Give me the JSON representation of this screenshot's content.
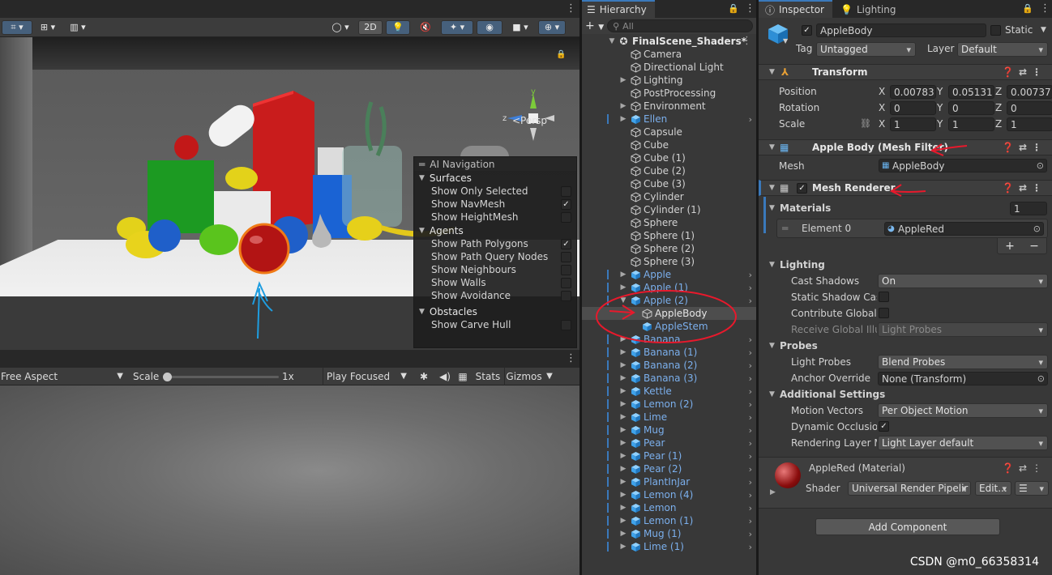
{
  "scene_toolbar": {
    "btn_2d": "2D",
    "kebab": "⋮"
  },
  "scene": {
    "persp_label": "<Persp",
    "gizmo_axes": {
      "y": "y",
      "z": "z"
    }
  },
  "ai_nav": {
    "title": "AI Navigation",
    "surfaces": "Surfaces",
    "surfaces_items": [
      {
        "label": "Show Only Selected",
        "checked": false
      },
      {
        "label": "Show NavMesh",
        "checked": true
      },
      {
        "label": "Show HeightMesh",
        "checked": false
      }
    ],
    "agents": "Agents",
    "agents_items": [
      {
        "label": "Show Path Polygons",
        "checked": true
      },
      {
        "label": "Show Path Query Nodes",
        "checked": false
      },
      {
        "label": "Show Neighbours",
        "checked": false
      },
      {
        "label": "Show Walls",
        "checked": false
      },
      {
        "label": "Show Avoidance",
        "checked": false
      }
    ],
    "obstacles": "Obstacles",
    "obstacles_items": [
      {
        "label": "Show Carve Hull",
        "checked": false
      }
    ]
  },
  "game_toolbar": {
    "aspect": "Free Aspect",
    "scale_label": "Scale",
    "scale_value": "1x",
    "scale_level": 0.0,
    "play_mode": "Play Focused",
    "stats": "Stats",
    "gizmos": "Gizmos"
  },
  "hierarchy": {
    "tab": "Hierarchy",
    "search_placeholder": "All",
    "add": "+",
    "scene_name": "FinalScene_Shaders*",
    "items": [
      {
        "label": "Camera",
        "prefab": false,
        "expand": "",
        "level": 1
      },
      {
        "label": "Directional Light",
        "prefab": false,
        "expand": "",
        "level": 1
      },
      {
        "label": "Lighting",
        "prefab": false,
        "expand": "▶",
        "level": 1
      },
      {
        "label": "PostProcessing",
        "prefab": false,
        "expand": "",
        "level": 1
      },
      {
        "label": "Environment",
        "prefab": false,
        "expand": "▶",
        "level": 1
      },
      {
        "label": "Ellen",
        "prefab": true,
        "expand": "▶",
        "level": 1,
        "chev": true,
        "bar": true
      },
      {
        "label": "Capsule",
        "prefab": false,
        "expand": "",
        "level": 1
      },
      {
        "label": "Cube",
        "prefab": false,
        "expand": "",
        "level": 1
      },
      {
        "label": "Cube (1)",
        "prefab": false,
        "expand": "",
        "level": 1
      },
      {
        "label": "Cube (2)",
        "prefab": false,
        "expand": "",
        "level": 1
      },
      {
        "label": "Cube (3)",
        "prefab": false,
        "expand": "",
        "level": 1
      },
      {
        "label": "Cylinder",
        "prefab": false,
        "expand": "",
        "level": 1
      },
      {
        "label": "Cylinder (1)",
        "prefab": false,
        "expand": "",
        "level": 1
      },
      {
        "label": "Sphere",
        "prefab": false,
        "expand": "",
        "level": 1
      },
      {
        "label": "Sphere (1)",
        "prefab": false,
        "expand": "",
        "level": 1
      },
      {
        "label": "Sphere (2)",
        "prefab": false,
        "expand": "",
        "level": 1
      },
      {
        "label": "Sphere (3)",
        "prefab": false,
        "expand": "",
        "level": 1
      },
      {
        "label": "Apple",
        "prefab": true,
        "expand": "▶",
        "level": 1,
        "chev": true,
        "bar": true
      },
      {
        "label": "Apple (1)",
        "prefab": true,
        "expand": "▶",
        "level": 1,
        "chev": true,
        "bar": true
      },
      {
        "label": "Apple (2)",
        "prefab": true,
        "expand": "▼",
        "level": 1,
        "chev": true,
        "bar": true
      },
      {
        "label": "AppleBody",
        "prefab": false,
        "expand": "",
        "level": 2,
        "selected": true
      },
      {
        "label": "AppleStem",
        "prefab": true,
        "expand": "",
        "level": 2
      },
      {
        "label": "Banana",
        "prefab": true,
        "expand": "▶",
        "level": 1,
        "chev": true,
        "bar": true
      },
      {
        "label": "Banana (1)",
        "prefab": true,
        "expand": "▶",
        "level": 1,
        "chev": true,
        "bar": true
      },
      {
        "label": "Banana (2)",
        "prefab": true,
        "expand": "▶",
        "level": 1,
        "chev": true,
        "bar": true
      },
      {
        "label": "Banana (3)",
        "prefab": true,
        "expand": "▶",
        "level": 1,
        "chev": true,
        "bar": true
      },
      {
        "label": "Kettle",
        "prefab": true,
        "expand": "▶",
        "level": 1,
        "chev": true,
        "bar": true
      },
      {
        "label": "Lemon (2)",
        "prefab": true,
        "expand": "▶",
        "level": 1,
        "chev": true,
        "bar": true
      },
      {
        "label": "Lime",
        "prefab": true,
        "expand": "▶",
        "level": 1,
        "chev": true,
        "bar": true
      },
      {
        "label": "Mug",
        "prefab": true,
        "expand": "▶",
        "level": 1,
        "chev": true,
        "bar": true
      },
      {
        "label": "Pear",
        "prefab": true,
        "expand": "▶",
        "level": 1,
        "chev": true,
        "bar": true
      },
      {
        "label": "Pear (1)",
        "prefab": true,
        "expand": "▶",
        "level": 1,
        "chev": true,
        "bar": true
      },
      {
        "label": "Pear (2)",
        "prefab": true,
        "expand": "▶",
        "level": 1,
        "chev": true,
        "bar": true
      },
      {
        "label": "PlantInJar",
        "prefab": true,
        "expand": "▶",
        "level": 1,
        "chev": true,
        "bar": true
      },
      {
        "label": "Lemon (4)",
        "prefab": true,
        "expand": "▶",
        "level": 1,
        "chev": true,
        "bar": true
      },
      {
        "label": "Lemon",
        "prefab": true,
        "expand": "▶",
        "level": 1,
        "chev": true,
        "bar": true
      },
      {
        "label": "Lemon (1)",
        "prefab": true,
        "expand": "▶",
        "level": 1,
        "chev": true,
        "bar": true
      },
      {
        "label": "Mug (1)",
        "prefab": true,
        "expand": "▶",
        "level": 1,
        "chev": true,
        "bar": true
      },
      {
        "label": "Lime (1)",
        "prefab": true,
        "expand": "▶",
        "level": 1,
        "chev": true,
        "bar": true
      }
    ]
  },
  "inspector": {
    "tab_inspector": "Inspector",
    "tab_lighting": "Lighting",
    "object_name": "AppleBody",
    "static_label": "Static",
    "tag_label": "Tag",
    "tag_value": "Untagged",
    "layer_label": "Layer",
    "layer_value": "Default",
    "transform": {
      "title": "Transform",
      "position_label": "Position",
      "rotation_label": "Rotation",
      "scale_label": "Scale",
      "x": "X",
      "y": "Y",
      "z": "Z",
      "position": [
        "0.00783",
        "0.05131",
        "0.00737"
      ],
      "rotation": [
        "0",
        "0",
        "0"
      ],
      "scale": [
        "1",
        "1",
        "1"
      ]
    },
    "mesh_filter": {
      "title": "Apple Body (Mesh Filter)",
      "mesh_label": "Mesh",
      "mesh_value": "AppleBody"
    },
    "mesh_renderer": {
      "title": "Mesh Renderer",
      "materials_label": "Materials",
      "materials_count": "1",
      "element_label": "Element 0",
      "element_value": "AppleRed",
      "plus": "+",
      "minus": "−",
      "lighting_label": "Lighting",
      "cast_shadows_label": "Cast Shadows",
      "cast_shadows_value": "On",
      "static_shadow_label": "Static Shadow Cas",
      "contribute_gi_label": "Contribute Global I",
      "receive_gi_label": "Receive Global Illu",
      "receive_gi_value": "Light Probes",
      "probes_label": "Probes",
      "light_probes_label": "Light Probes",
      "light_probes_value": "Blend Probes",
      "anchor_label": "Anchor Override",
      "anchor_value": "None (Transform)",
      "additional_label": "Additional Settings",
      "motion_label": "Motion Vectors",
      "motion_value": "Per Object Motion",
      "dynamic_occ_label": "Dynamic Occlusion",
      "rendering_layer_label": "Rendering Layer M",
      "rendering_layer_value": "Light Layer default"
    },
    "material": {
      "name": "AppleRed (Material)",
      "shader_label": "Shader",
      "shader_value": "Universal Render Pipelir",
      "edit": "Edit...",
      "menu": "☰"
    },
    "add_component": "Add Component"
  },
  "watermark": "CSDN @m0_66358314",
  "colors": {
    "accent": "#3a79bb",
    "prefab_text": "#7bafec",
    "annotation_red": "#e8192c",
    "annotation_blue": "#1e9de0"
  }
}
